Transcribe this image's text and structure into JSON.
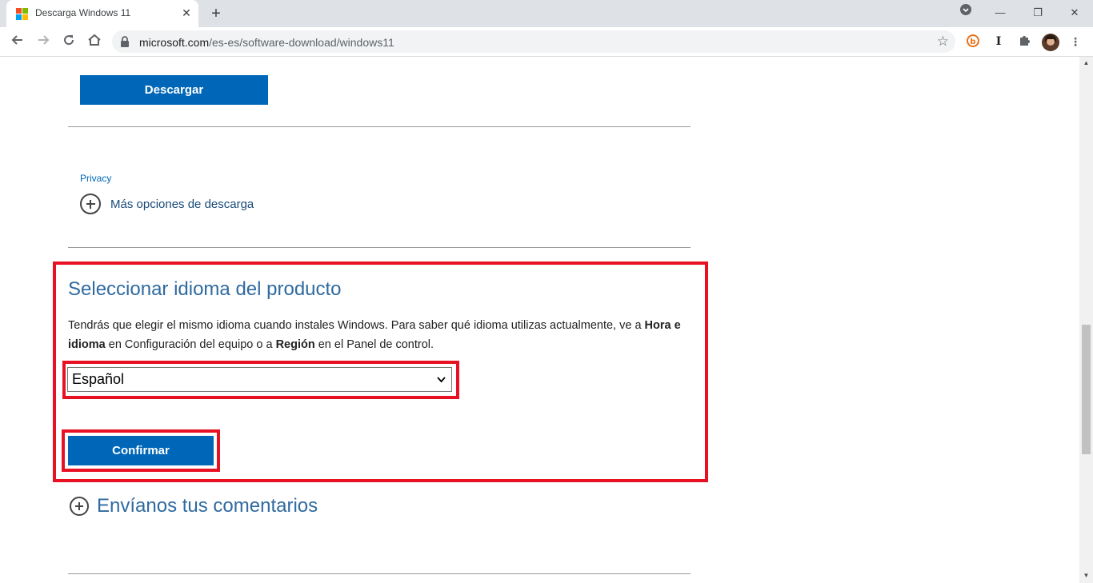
{
  "browser": {
    "tab_title": "Descarga Windows 11",
    "tab_close": "✕",
    "new_tab": "+",
    "url_host": "microsoft.com",
    "url_path": "/es-es/software-download/windows11",
    "window_controls": {
      "minimize": "—",
      "restore": "❐",
      "close": "✕"
    },
    "icons": [
      "back-icon",
      "forward-icon",
      "reload-icon",
      "home-icon",
      "lock-icon",
      "star-icon",
      "extension-b-icon",
      "extension-i-icon",
      "puzzle-icon",
      "avatar",
      "menu-icon"
    ]
  },
  "page": {
    "download_button": "Descargar",
    "privacy_link": "Privacy",
    "more_options": "Más opciones de descarga",
    "language_section": {
      "title": "Seleccionar idioma del producto",
      "desc_part1": "Tendrás que elegir el mismo idioma cuando instales Windows. Para saber qué idioma utilizas actualmente, ve a ",
      "desc_bold1": "Hora e idioma",
      "desc_part2": " en Configuración del equipo o a ",
      "desc_bold2": "Región",
      "desc_part3": " en el Panel de control.",
      "selected_language": "Español",
      "confirm_button": "Confirmar"
    },
    "feedback": "Envíanos tus comentarios"
  },
  "colors": {
    "accent_blue": "#0067b8",
    "heading_blue": "#2f6aa0",
    "highlight_red": "#e81123"
  }
}
